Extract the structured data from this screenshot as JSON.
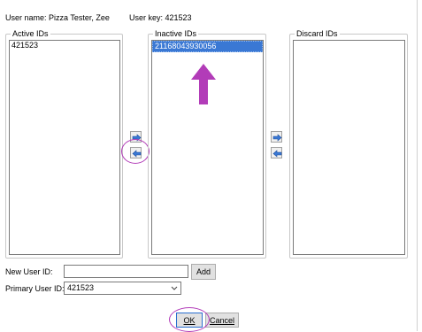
{
  "header": {
    "user_name": "User name: Pizza Tester, Zee",
    "user_key": "User key: 421523"
  },
  "active": {
    "title": "Active IDs",
    "items": [
      "421523"
    ]
  },
  "inactive": {
    "title": "Inactive IDs",
    "items": [
      "21168043930056"
    ],
    "selected_index": 0
  },
  "discard": {
    "title": "Discard IDs",
    "items": []
  },
  "buttons": {
    "add": "Add",
    "ok": "OK",
    "cancel": "Cancel"
  },
  "form": {
    "new_user_label": "New User ID:",
    "new_user_value": "",
    "primary_label": "Primary User ID:",
    "primary_value": "421523"
  },
  "annotations": {
    "color": "#b23cb8"
  },
  "icons": {
    "move_right": "arrow-right-icon",
    "move_left": "arrow-left-icon",
    "combo": "chevron-down-icon"
  }
}
